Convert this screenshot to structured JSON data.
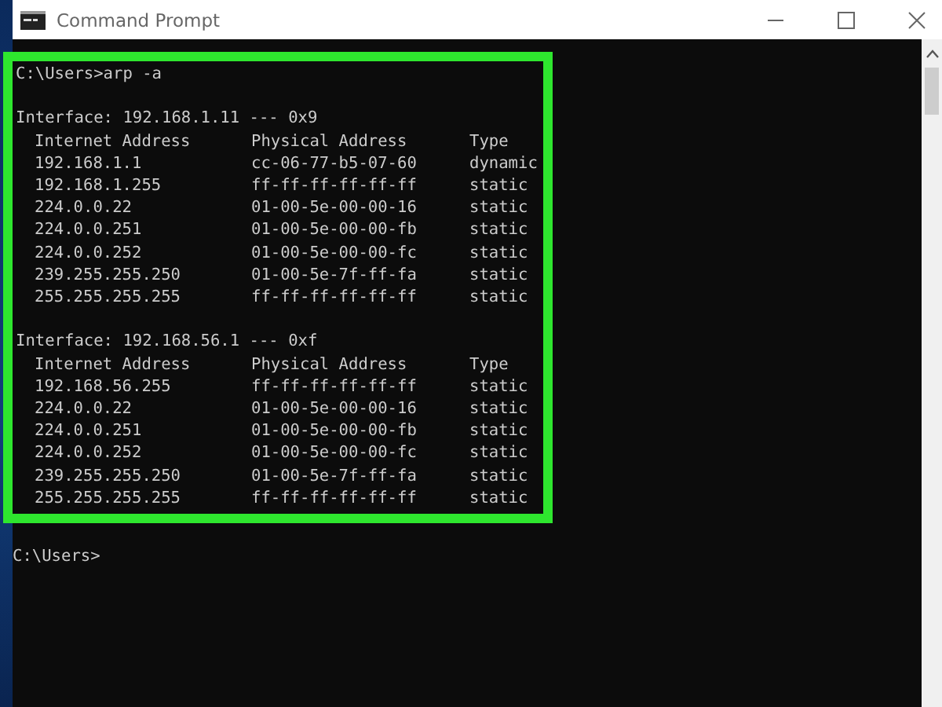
{
  "window": {
    "title": "Command Prompt"
  },
  "command_line": "C:\\Users>arp -a",
  "interfaces": [
    {
      "header": "Interface: 192.168.1.11 --- 0x9",
      "columns": [
        "Internet Address",
        "Physical Address",
        "Type"
      ],
      "rows": [
        {
          "internet_address": "192.168.1.1",
          "physical_address": "cc-06-77-b5-07-60",
          "type": "dynamic"
        },
        {
          "internet_address": "192.168.1.255",
          "physical_address": "ff-ff-ff-ff-ff-ff",
          "type": "static"
        },
        {
          "internet_address": "224.0.0.22",
          "physical_address": "01-00-5e-00-00-16",
          "type": "static"
        },
        {
          "internet_address": "224.0.0.251",
          "physical_address": "01-00-5e-00-00-fb",
          "type": "static"
        },
        {
          "internet_address": "224.0.0.252",
          "physical_address": "01-00-5e-00-00-fc",
          "type": "static"
        },
        {
          "internet_address": "239.255.255.250",
          "physical_address": "01-00-5e-7f-ff-fa",
          "type": "static"
        },
        {
          "internet_address": "255.255.255.255",
          "physical_address": "ff-ff-ff-ff-ff-ff",
          "type": "static"
        }
      ]
    },
    {
      "header": "Interface: 192.168.56.1 --- 0xf",
      "columns": [
        "Internet Address",
        "Physical Address",
        "Type"
      ],
      "rows": [
        {
          "internet_address": "192.168.56.255",
          "physical_address": "ff-ff-ff-ff-ff-ff",
          "type": "static"
        },
        {
          "internet_address": "224.0.0.22",
          "physical_address": "01-00-5e-00-00-16",
          "type": "static"
        },
        {
          "internet_address": "224.0.0.251",
          "physical_address": "01-00-5e-00-00-fb",
          "type": "static"
        },
        {
          "internet_address": "224.0.0.252",
          "physical_address": "01-00-5e-00-00-fc",
          "type": "static"
        },
        {
          "internet_address": "239.255.255.250",
          "physical_address": "01-00-5e-7f-ff-fa",
          "type": "static"
        },
        {
          "internet_address": "255.255.255.255",
          "physical_address": "ff-ff-ff-ff-ff-ff",
          "type": "static"
        }
      ]
    }
  ],
  "prompt": "C:\\Users>"
}
